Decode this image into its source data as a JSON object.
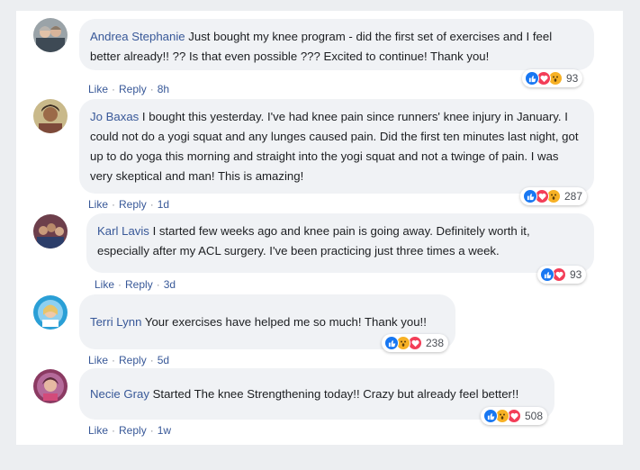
{
  "comments": [
    {
      "author": "Andrea Stephanie",
      "text": "Just bought my knee program - did the first set of exercises and I feel better already!! ?? Is that even possible ??? Excited to continue! Thank you!",
      "like": "Like",
      "reply": "Reply",
      "time": "8h",
      "reactions": [
        "like",
        "love",
        "wow"
      ],
      "count": "93"
    },
    {
      "author": "Jo Baxas",
      "text": "I bought this yesterday. I've had knee pain since runners' knee injury in January. I could not do a yogi squat and any lunges caused pain. Did the first ten minutes last night, got up to do yoga this morning and straight into the yogi squat and not a twinge of pain. I was very skeptical and man! This is amazing!",
      "like": "Like",
      "reply": "Reply",
      "time": "1d",
      "reactions": [
        "like",
        "love",
        "wow"
      ],
      "count": "287"
    },
    {
      "author": "Karl Lavis",
      "text": "I started few weeks ago and knee pain is going away. Definitely worth it, especially after my ACL surgery. I've been practicing just three times a week.",
      "like": "Like",
      "reply": "Reply",
      "time": "3d",
      "reactions": [
        "like",
        "love"
      ],
      "count": "93"
    },
    {
      "author": "Terri Lynn",
      "text": "Your exercises have helped me so much! Thank you!!",
      "like": "Like",
      "reply": "Reply",
      "time": "5d",
      "reactions": [
        "like",
        "wow",
        "love"
      ],
      "count": "238"
    },
    {
      "author": "Necie Gray",
      "text": "Started The knee Strengthening today!! Crazy but already feel better!!",
      "like": "Like",
      "reply": "Reply",
      "time": "1w",
      "reactions": [
        "like",
        "wow",
        "love"
      ],
      "count": "508"
    }
  ],
  "colors": {
    "author": "#385898",
    "bubble": "#f0f2f5",
    "like": "#1877f2",
    "love": "#f33e58",
    "wow": "#f7b125"
  }
}
